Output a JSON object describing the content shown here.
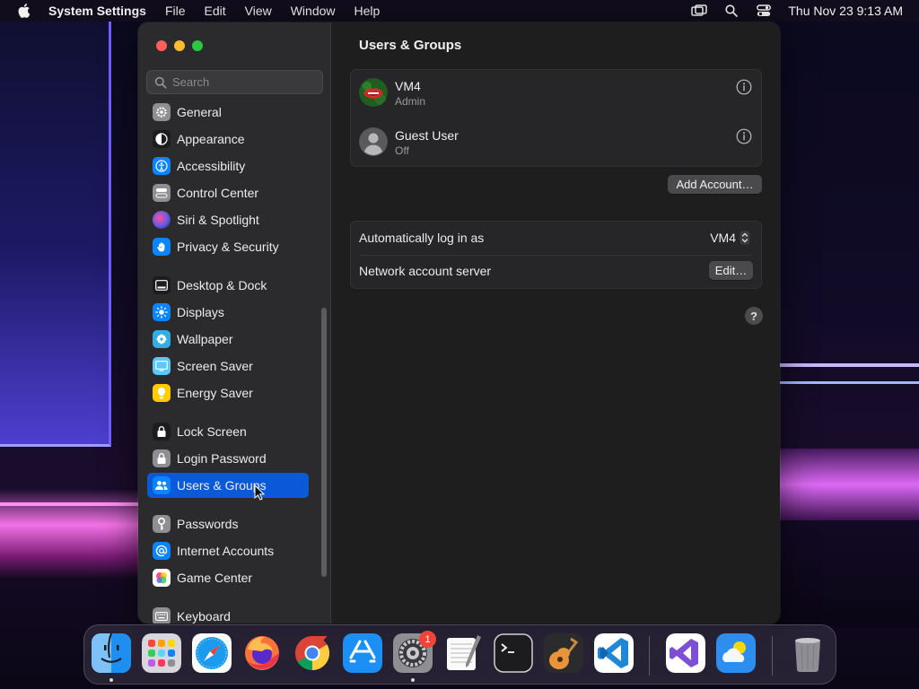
{
  "menubar": {
    "app_name": "System Settings",
    "menus": [
      "File",
      "Edit",
      "View",
      "Window",
      "Help"
    ],
    "datetime": "Thu Nov 23  9:13 AM",
    "status_icons": [
      "screen-mirroring-icon",
      "spotlight-search-icon",
      "control-center-icon"
    ]
  },
  "sidebar": {
    "search_placeholder": "Search",
    "items": [
      {
        "label": "General",
        "icon": "gear-icon",
        "color": "#8e8e93"
      },
      {
        "label": "Appearance",
        "icon": "appearance-icon",
        "color": "#1c1c1e"
      },
      {
        "label": "Accessibility",
        "icon": "accessibility-icon",
        "color": "#0a84ff"
      },
      {
        "label": "Control Center",
        "icon": "control-center-icon",
        "color": "#8e8e93"
      },
      {
        "label": "Siri & Spotlight",
        "icon": "siri-icon",
        "color": "#5e5ce6"
      },
      {
        "label": "Privacy & Security",
        "icon": "hand-icon",
        "color": "#0a84ff"
      },
      {
        "label": "Desktop & Dock",
        "icon": "dock-icon",
        "color": "#1c1c1e"
      },
      {
        "label": "Displays",
        "icon": "sun-icon",
        "color": "#0a84ff"
      },
      {
        "label": "Wallpaper",
        "icon": "flower-icon",
        "color": "#32ade6"
      },
      {
        "label": "Screen Saver",
        "icon": "screensaver-icon",
        "color": "#5ac8fa"
      },
      {
        "label": "Energy Saver",
        "icon": "lightbulb-icon",
        "color": "#ffcc00"
      },
      {
        "label": "Lock Screen",
        "icon": "lock-screen-icon",
        "color": "#1c1c1e"
      },
      {
        "label": "Login Password",
        "icon": "lock-icon",
        "color": "#8e8e93"
      },
      {
        "label": "Users & Groups",
        "icon": "users-icon",
        "color": "#0a84ff"
      },
      {
        "label": "Passwords",
        "icon": "key-icon",
        "color": "#8e8e93"
      },
      {
        "label": "Internet Accounts",
        "icon": "at-icon",
        "color": "#0a84ff"
      },
      {
        "label": "Game Center",
        "icon": "game-center-icon",
        "color": "#ffffff"
      },
      {
        "label": "Keyboard",
        "icon": "keyboard-icon",
        "color": "#8e8e93"
      }
    ],
    "selected": "Users & Groups"
  },
  "content": {
    "title": "Users & Groups",
    "users": [
      {
        "name": "VM4",
        "role": "Admin"
      },
      {
        "name": "Guest User",
        "role": "Off"
      }
    ],
    "add_account_label": "Add Account…",
    "settings": [
      {
        "label": "Automatically log in as",
        "value": "VM4"
      },
      {
        "label": "Network account server",
        "button": "Edit…"
      }
    ],
    "help_label": "?"
  },
  "dock": {
    "apps": [
      "Finder",
      "Launchpad",
      "Safari",
      "Firefox",
      "Google Chrome",
      "App Store",
      "System Settings",
      "TextEdit",
      "Terminal",
      "GarageBand",
      "Visual Studio Code",
      "Visual Studio",
      "Weather",
      "Trash"
    ],
    "system_settings_badge": "1"
  }
}
